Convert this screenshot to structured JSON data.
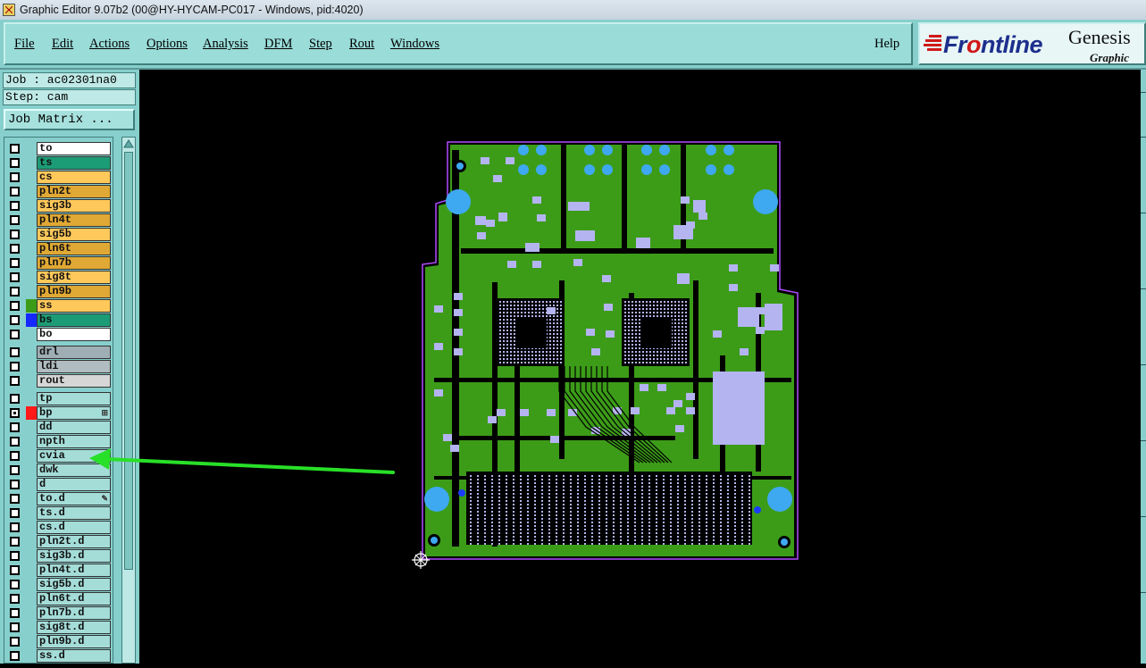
{
  "window": {
    "title": "Graphic Editor 9.07b2 (00@HY-HYCAM-PC017 - Windows, pid:4020)"
  },
  "menu": {
    "items": [
      {
        "label": "File"
      },
      {
        "label": "Edit"
      },
      {
        "label": "Actions"
      },
      {
        "label": "Options"
      },
      {
        "label": "Analysis"
      },
      {
        "label": "DFM"
      },
      {
        "label": "Step"
      },
      {
        "label": "Rout"
      },
      {
        "label": "Windows"
      }
    ],
    "help": "Help"
  },
  "logo": {
    "brand_prefix": "Fr",
    "brand_o": "o",
    "brand_suffix": "ntline",
    "product": "Genesis",
    "subtitle": "Graphic Ed"
  },
  "job": {
    "job_text": "Job : ac02301na0",
    "step_text": "Step: cam",
    "matrix_button": "Job Matrix ..."
  },
  "layers": [
    {
      "name": "to",
      "bg": "#ffffff",
      "swatch": ""
    },
    {
      "name": "ts",
      "bg": "#1c9c76",
      "swatch": ""
    },
    {
      "name": "cs",
      "bg": "#ffc85a",
      "swatch": ""
    },
    {
      "name": "pln2t",
      "bg": "#e0a834",
      "swatch": ""
    },
    {
      "name": "sig3b",
      "bg": "#ffc85a",
      "swatch": ""
    },
    {
      "name": "pln4t",
      "bg": "#e0a834",
      "swatch": ""
    },
    {
      "name": "sig5b",
      "bg": "#ffc85a",
      "swatch": ""
    },
    {
      "name": "pln6t",
      "bg": "#e0a834",
      "swatch": ""
    },
    {
      "name": "pln7b",
      "bg": "#e0a834",
      "swatch": ""
    },
    {
      "name": "sig8t",
      "bg": "#ffc85a",
      "swatch": ""
    },
    {
      "name": "pln9b",
      "bg": "#e0a834",
      "swatch": ""
    },
    {
      "name": "ss",
      "bg": "#ffc85a",
      "swatch": "#3c9c18"
    },
    {
      "name": "bs",
      "bg": "#1c9c76",
      "swatch": "#1428ff"
    },
    {
      "name": "bo",
      "bg": "#ffffff",
      "swatch": ""
    },
    {
      "name": "drl",
      "bg": "#9eaeb4",
      "swatch": ""
    },
    {
      "name": "ldi",
      "bg": "#b0bcc0",
      "swatch": ""
    },
    {
      "name": "rout",
      "bg": "#d6d6d6",
      "swatch": ""
    },
    {
      "name": "tp",
      "bg": "#a4dcd8",
      "swatch": ""
    },
    {
      "name": "bp",
      "bg": "#a4dcd8",
      "swatch": "#ff1a1a",
      "checked": true,
      "mark": "⊞"
    },
    {
      "name": "dd",
      "bg": "#a4dcd8",
      "swatch": ""
    },
    {
      "name": "npth",
      "bg": "#a4dcd8",
      "swatch": ""
    },
    {
      "name": "cvia",
      "bg": "#a4dcd8",
      "swatch": ""
    },
    {
      "name": "dwk",
      "bg": "#a4dcd8",
      "swatch": ""
    },
    {
      "name": "d",
      "bg": "#a4dcd8",
      "swatch": ""
    },
    {
      "name": "to.d",
      "bg": "#a4dcd8",
      "swatch": "",
      "mark": "✎"
    },
    {
      "name": "ts.d",
      "bg": "#a4dcd8",
      "swatch": ""
    },
    {
      "name": "cs.d",
      "bg": "#a4dcd8",
      "swatch": ""
    },
    {
      "name": "pln2t.d",
      "bg": "#a4dcd8",
      "swatch": ""
    },
    {
      "name": "sig3b.d",
      "bg": "#a4dcd8",
      "swatch": ""
    },
    {
      "name": "pln4t.d",
      "bg": "#a4dcd8",
      "swatch": ""
    },
    {
      "name": "sig5b.d",
      "bg": "#a4dcd8",
      "swatch": ""
    },
    {
      "name": "pln6t.d",
      "bg": "#a4dcd8",
      "swatch": ""
    },
    {
      "name": "pln7b.d",
      "bg": "#a4dcd8",
      "swatch": ""
    },
    {
      "name": "sig8t.d",
      "bg": "#a4dcd8",
      "swatch": ""
    },
    {
      "name": "pln9b.d",
      "bg": "#a4dcd8",
      "swatch": ""
    },
    {
      "name": "ss.d",
      "bg": "#a4dcd8",
      "swatch": ""
    }
  ],
  "colors": {
    "panel": "#87cfcc",
    "board_fill": "#3c9c18",
    "board_outline": "#b04cff",
    "pad": "#b4b4f0",
    "hole": "#3ea8f0",
    "annotation_arrow": "#28e028"
  },
  "icons": {
    "origin": "crosshair-origin-icon",
    "arrow": "annotation-arrow"
  }
}
